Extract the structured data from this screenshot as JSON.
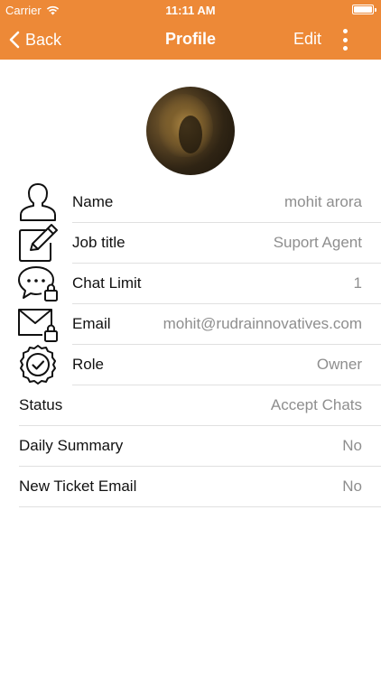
{
  "status_bar": {
    "carrier": "Carrier",
    "time": "11:11 AM"
  },
  "nav": {
    "back_label": "Back",
    "title": "Profile",
    "edit_label": "Edit"
  },
  "fields": [
    {
      "label": "Name",
      "value": "mohit arora",
      "icon": "person-icon"
    },
    {
      "label": "Job title",
      "value": "Suport Agent",
      "icon": "pencil-edit-icon"
    },
    {
      "label": "Chat Limit",
      "value": "1",
      "icon": "chat-bubble-lock-icon"
    },
    {
      "label": "Email",
      "value": "mohit@rudrainnovatives.com",
      "icon": "envelope-lock-icon"
    },
    {
      "label": "Role",
      "value": "Owner",
      "icon": "badge-check-icon"
    },
    {
      "label": "Status",
      "value": "Accept Chats"
    },
    {
      "label": "Daily Summary",
      "value": "No"
    },
    {
      "label": "New Ticket Email",
      "value": "No"
    }
  ],
  "colors": {
    "accent": "#ED8937",
    "value_text": "#8e8e8e",
    "divider": "#e0e0e0"
  }
}
